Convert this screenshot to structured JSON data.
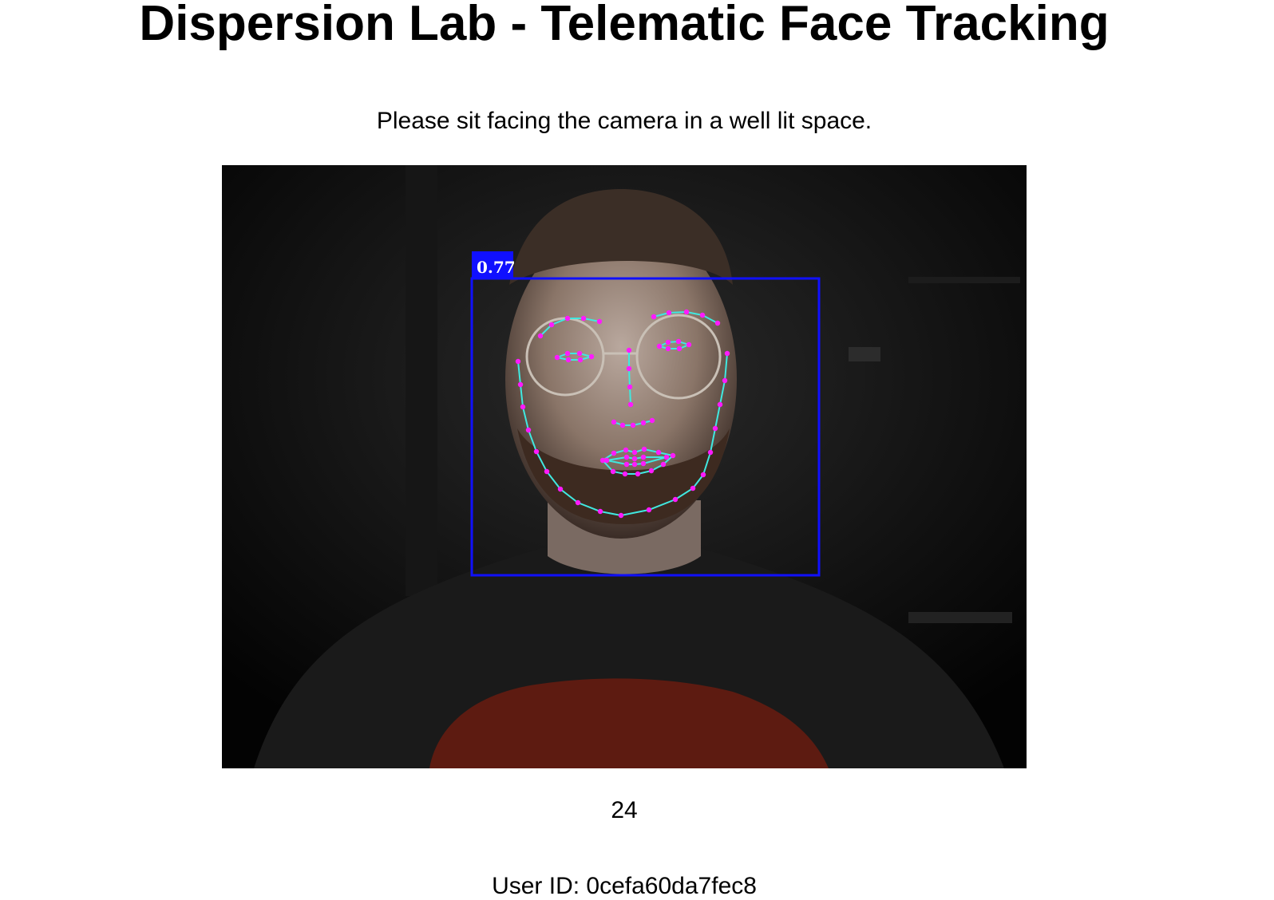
{
  "header": {
    "title": "Dispersion Lab - Telematic Face Tracking"
  },
  "instructions": {
    "text": "Please sit facing the camera in a well lit space."
  },
  "video": {
    "detection": {
      "confidence_label": "0.77",
      "box_color": "#1010ff",
      "landmark_color": "#ff1aff",
      "contour_color": "#40e8e0"
    }
  },
  "frame_counter": {
    "value": "24"
  },
  "user": {
    "label": "User ID:",
    "id": "0cefa60da7fec8"
  }
}
